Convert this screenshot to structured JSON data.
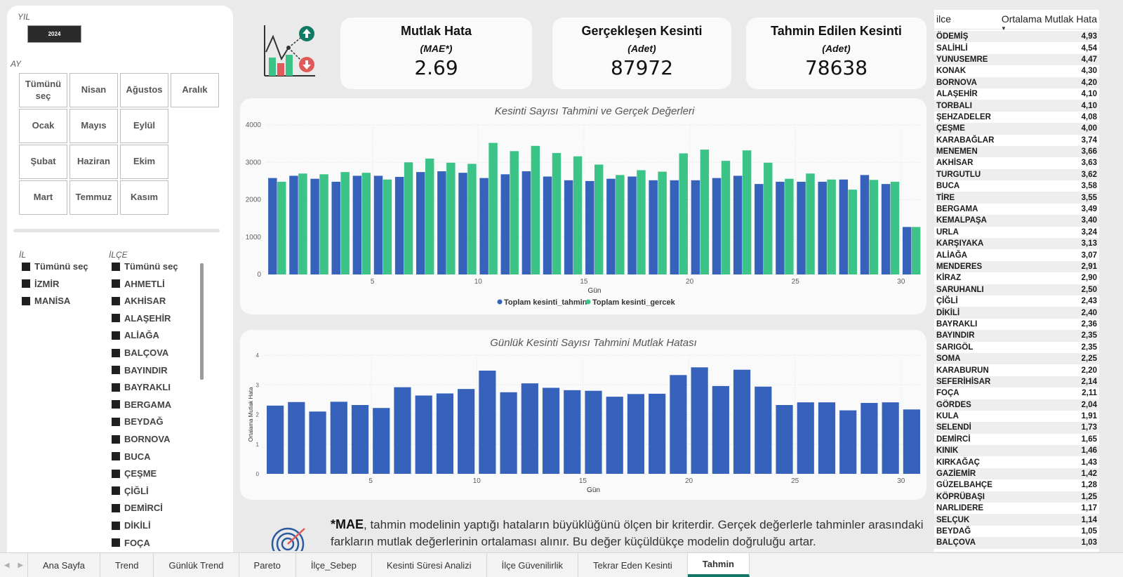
{
  "filters": {
    "year_label": "YIL",
    "year_value": "2024",
    "month_label": "AY",
    "months": [
      {
        "label": "Tümünü seç",
        "col": 0,
        "row": 0
      },
      {
        "label": "Nisan",
        "col": 1,
        "row": 0
      },
      {
        "label": "Ağustos",
        "col": 2,
        "row": 0
      },
      {
        "label": "Aralık",
        "col": 3,
        "row": 0
      },
      {
        "label": "Ocak",
        "col": 0,
        "row": 1
      },
      {
        "label": "Mayıs",
        "col": 1,
        "row": 1
      },
      {
        "label": "Eylül",
        "col": 2,
        "row": 1
      },
      {
        "label": "Şubat",
        "col": 0,
        "row": 2
      },
      {
        "label": "Haziran",
        "col": 1,
        "row": 2
      },
      {
        "label": "Ekim",
        "col": 2,
        "row": 2
      },
      {
        "label": "Mart",
        "col": 0,
        "row": 3
      },
      {
        "label": "Temmuz",
        "col": 1,
        "row": 3
      },
      {
        "label": "Kasım",
        "col": 2,
        "row": 3
      }
    ],
    "il_label": "İL",
    "il_items": [
      "Tümünü seç",
      "İZMİR",
      "MANİSA"
    ],
    "ilce_label": "İLÇE",
    "ilce_items": [
      "Tümünü seç",
      "AHMETLİ",
      "AKHİSAR",
      "ALAŞEHİR",
      "ALİAĞA",
      "BALÇOVA",
      "BAYINDIR",
      "BAYRAKLI",
      "BERGAMA",
      "BEYDAĞ",
      "BORNOVA",
      "BUCA",
      "ÇEŞME",
      "ÇİĞLİ",
      "DEMİRCİ",
      "DİKİLİ",
      "FOÇA"
    ]
  },
  "kpis": [
    {
      "title": "Mutlak Hata",
      "subtitle": "(MAE*)",
      "value": "2.69"
    },
    {
      "title": "Gerçekleşen Kesinti",
      "subtitle": "(Adet)",
      "value": "87972"
    },
    {
      "title": "Tahmin Edilen Kesinti",
      "subtitle": "(Adet)",
      "value": "78638"
    }
  ],
  "colors": {
    "blue": "#3662bb",
    "green": "#3cc488",
    "icon_up": "#117a65",
    "icon_down": "#e05a5a"
  },
  "chart_data": [
    {
      "type": "bar",
      "title": "Kesinti Sayısı Tahmini ve Gerçek Değerleri",
      "xlabel": "Gün",
      "ylabel": "",
      "x": [
        1,
        2,
        3,
        4,
        5,
        6,
        7,
        8,
        9,
        10,
        11,
        12,
        13,
        14,
        15,
        16,
        17,
        18,
        19,
        20,
        21,
        22,
        23,
        24,
        25,
        26,
        27,
        28,
        29,
        30,
        31
      ],
      "xticks": [
        5,
        10,
        15,
        20,
        25,
        30
      ],
      "yticks": [
        0,
        1000,
        2000,
        3000,
        4000
      ],
      "ylim": [
        0,
        4000
      ],
      "legend_position": "bottom",
      "series": [
        {
          "name": "Toplam kesinti_tahmin",
          "color": "#3662bb",
          "values": [
            2580,
            2640,
            2560,
            2480,
            2640,
            2640,
            2610,
            2740,
            2760,
            2720,
            2580,
            2680,
            2760,
            2620,
            2520,
            2500,
            2560,
            2620,
            2520,
            2520,
            2520,
            2580,
            2640,
            2420,
            2480,
            2480,
            2480,
            2540,
            2660,
            2420,
            1270
          ]
        },
        {
          "name": "Toplam kesinti_gercek",
          "color": "#3cc488",
          "values": [
            2480,
            2700,
            2680,
            2740,
            2720,
            2540,
            3000,
            3100,
            2990,
            2960,
            3520,
            3300,
            3440,
            3250,
            3160,
            2940,
            2660,
            2790,
            2750,
            3240,
            3340,
            3040,
            3320,
            2990,
            2560,
            2700,
            2540,
            2270,
            2530,
            2480,
            1270
          ]
        }
      ]
    },
    {
      "type": "bar",
      "title": "Günlük Kesinti Sayısı Tahmini Mutlak Hatası",
      "xlabel": "Gün",
      "ylabel": "Ortalama Mutlak Hata",
      "x": [
        1,
        2,
        3,
        4,
        5,
        6,
        7,
        8,
        9,
        10,
        11,
        12,
        13,
        14,
        15,
        16,
        17,
        18,
        19,
        20,
        21,
        22,
        23,
        24,
        25,
        26,
        27,
        28,
        29,
        30,
        31
      ],
      "xticks": [
        5,
        10,
        15,
        20,
        25,
        30
      ],
      "yticks": [
        0,
        1,
        2,
        3,
        4
      ],
      "ylim": [
        0,
        4
      ],
      "series": [
        {
          "name": "Ortalama Mutlak Hata",
          "color": "#3662bb",
          "values": [
            2.3,
            2.42,
            2.1,
            2.43,
            2.32,
            2.22,
            2.92,
            2.64,
            2.71,
            2.86,
            3.48,
            2.75,
            3.05,
            2.9,
            2.82,
            2.8,
            2.6,
            2.69,
            2.7,
            3.33,
            3.59,
            2.96,
            3.51,
            2.94,
            2.32,
            2.41,
            2.41,
            2.14,
            2.39,
            2.41,
            2.17
          ]
        }
      ]
    }
  ],
  "note": {
    "bold": "*MAE",
    "text": ", tahmin modelinin yaptığı hataların büyüklüğünü ölçen bir kriterdir. Gerçek değerlerle tahminler arasındaki farkların mutlak değerlerinin ortalaması alınır. Bu değer küçüldükçe modelin doğruluğu artar."
  },
  "table": {
    "col_ilce": "ilce",
    "col_mae": "Ortalama Mutlak Hata",
    "rows": [
      [
        "ÖDEMİŞ",
        "4,93"
      ],
      [
        "SALİHLİ",
        "4,54"
      ],
      [
        "YUNUSEMRE",
        "4,47"
      ],
      [
        "KONAK",
        "4,30"
      ],
      [
        "BORNOVA",
        "4,20"
      ],
      [
        "ALAŞEHİR",
        "4,10"
      ],
      [
        "TORBALI",
        "4,10"
      ],
      [
        "ŞEHZADELER",
        "4,08"
      ],
      [
        "ÇEŞME",
        "4,00"
      ],
      [
        "KARABAĞLAR",
        "3,74"
      ],
      [
        "MENEMEN",
        "3,66"
      ],
      [
        "AKHİSAR",
        "3,63"
      ],
      [
        "TURGUTLU",
        "3,62"
      ],
      [
        "BUCA",
        "3,58"
      ],
      [
        "TİRE",
        "3,55"
      ],
      [
        "BERGAMA",
        "3,49"
      ],
      [
        "KEMALPAŞA",
        "3,40"
      ],
      [
        "URLA",
        "3,24"
      ],
      [
        "KARŞIYAKA",
        "3,13"
      ],
      [
        "ALİAĞA",
        "3,07"
      ],
      [
        "MENDERES",
        "2,91"
      ],
      [
        "KİRAZ",
        "2,90"
      ],
      [
        "SARUHANLI",
        "2,50"
      ],
      [
        "ÇİĞLİ",
        "2,43"
      ],
      [
        "DİKİLİ",
        "2,40"
      ],
      [
        "BAYRAKLI",
        "2,36"
      ],
      [
        "BAYINDIR",
        "2,35"
      ],
      [
        "SARIGÖL",
        "2,35"
      ],
      [
        "SOMA",
        "2,25"
      ],
      [
        "KARABURUN",
        "2,20"
      ],
      [
        "SEFERİHİSAR",
        "2,14"
      ],
      [
        "FOÇA",
        "2,11"
      ],
      [
        "GÖRDES",
        "2,04"
      ],
      [
        "KULA",
        "1,91"
      ],
      [
        "SELENDİ",
        "1,73"
      ],
      [
        "DEMİRCİ",
        "1,65"
      ],
      [
        "KINIK",
        "1,46"
      ],
      [
        "KIRKAĞAÇ",
        "1,43"
      ],
      [
        "GAZİEMİR",
        "1,42"
      ],
      [
        "GÜZELBAHÇE",
        "1,28"
      ],
      [
        "KÖPRÜBAŞI",
        "1,25"
      ],
      [
        "NARLIDERE",
        "1,17"
      ],
      [
        "SELÇUK",
        "1,14"
      ],
      [
        "BEYDAĞ",
        "1,05"
      ],
      [
        "BALÇOVA",
        "1,03"
      ]
    ]
  },
  "tabs": [
    {
      "label": "Ana Sayfa",
      "active": false
    },
    {
      "label": "Trend",
      "active": false
    },
    {
      "label": "Günlük Trend",
      "active": false
    },
    {
      "label": "Pareto",
      "active": false
    },
    {
      "label": "İlçe_Sebep",
      "active": false
    },
    {
      "label": "Kesinti Süresi Analizi",
      "active": false
    },
    {
      "label": "İlçe Güvenilirlik",
      "active": false
    },
    {
      "label": "Tekrar Eden Kesinti",
      "active": false
    },
    {
      "label": "Tahmin",
      "active": true
    }
  ]
}
